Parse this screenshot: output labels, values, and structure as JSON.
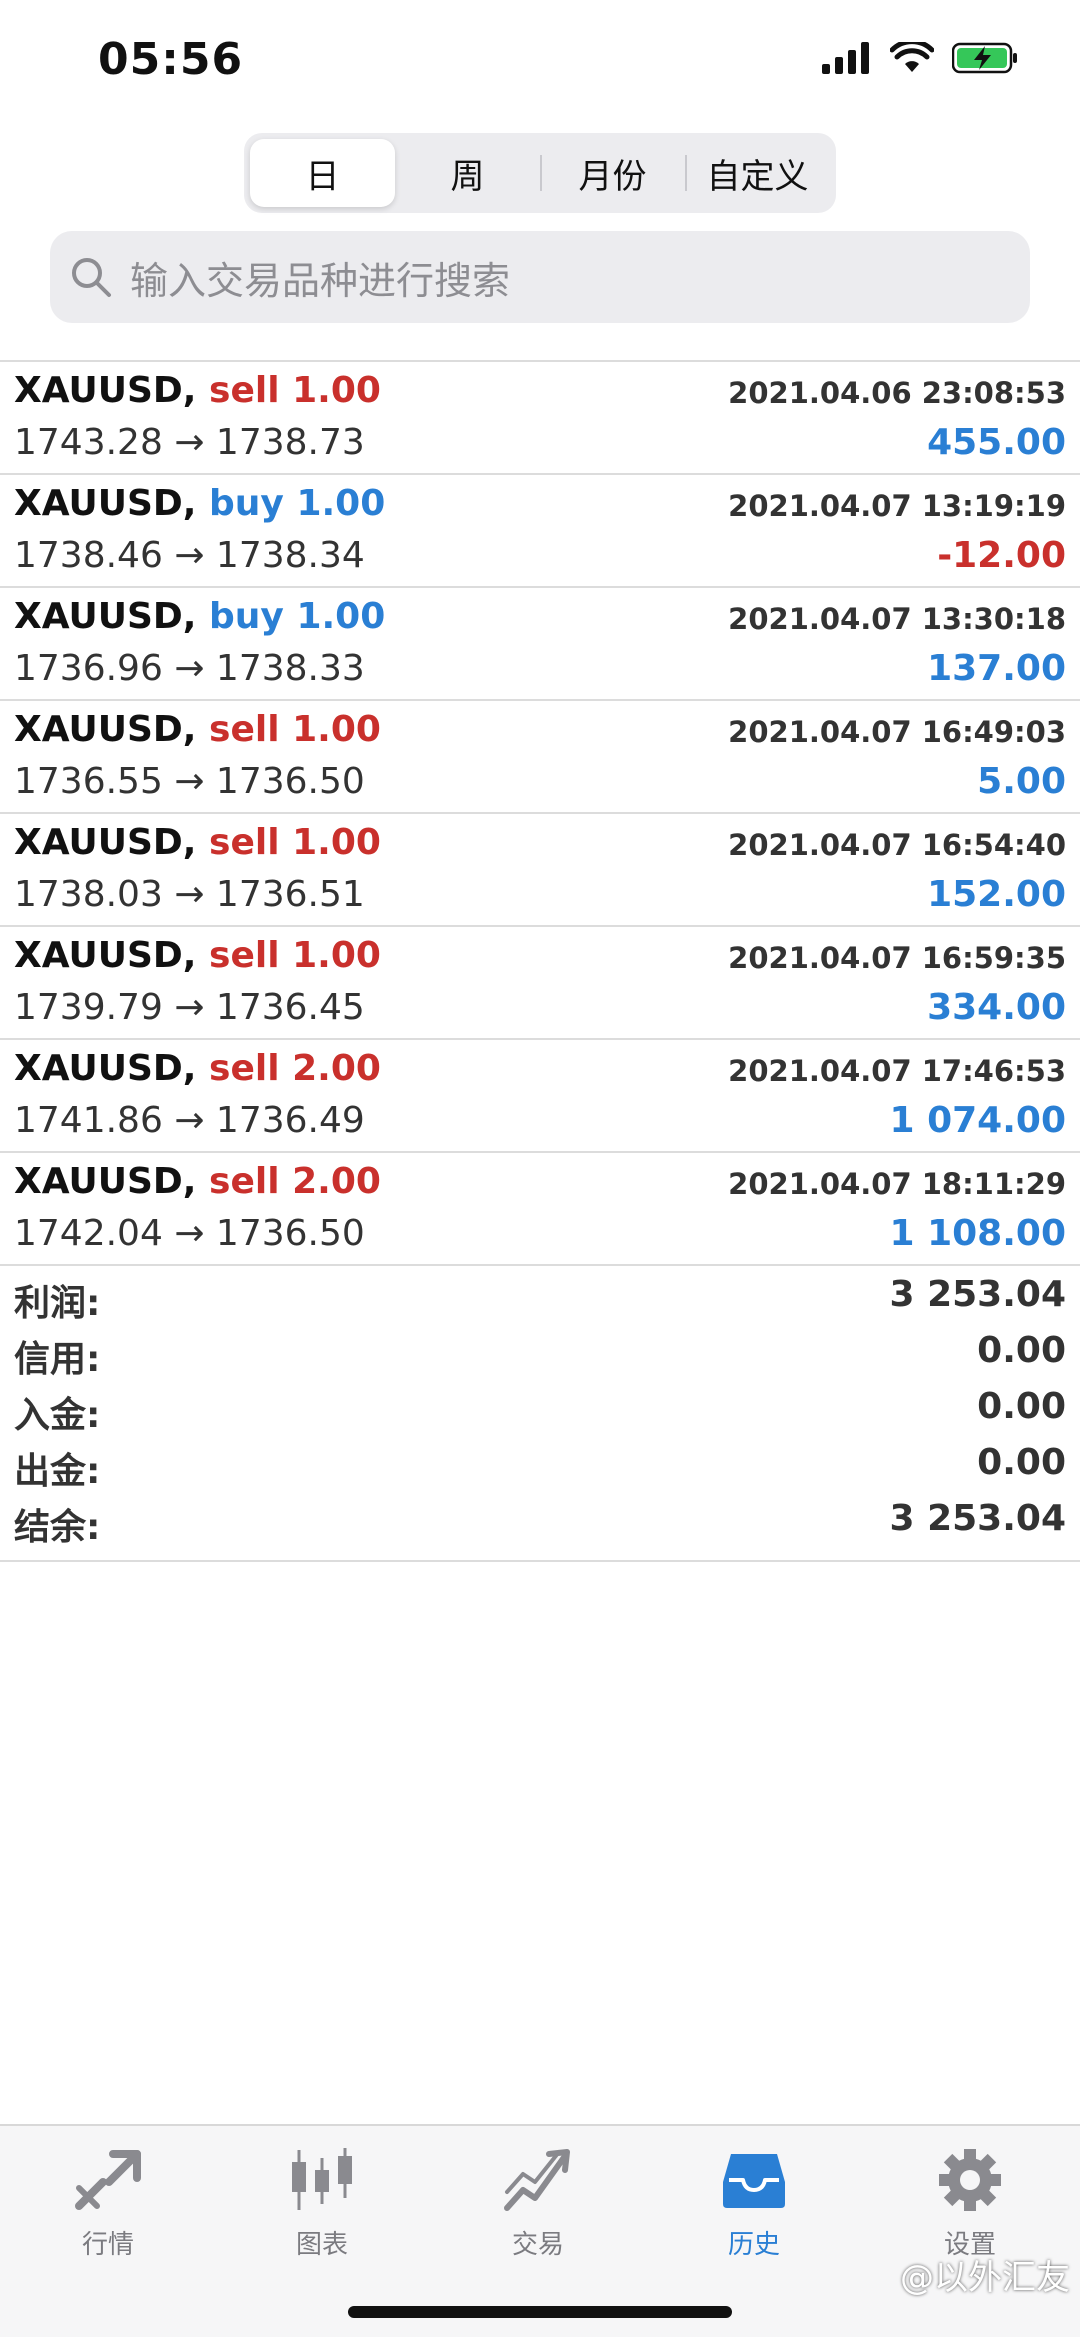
{
  "status": {
    "time": "05:56"
  },
  "segments": [
    "日",
    "周",
    "月份",
    "自定义"
  ],
  "search": {
    "placeholder": "输入交易品种进行搜索"
  },
  "deals": [
    {
      "symbol": "XAUUSD,",
      "side": "sell",
      "volume": "1.00",
      "time": "2021.04.06 23:08:53",
      "prices": "1743.28 → 1738.73",
      "profit": "455.00"
    },
    {
      "symbol": "XAUUSD,",
      "side": "buy",
      "volume": "1.00",
      "time": "2021.04.07 13:19:19",
      "prices": "1738.46 → 1738.34",
      "profit": "-12.00"
    },
    {
      "symbol": "XAUUSD,",
      "side": "buy",
      "volume": "1.00",
      "time": "2021.04.07 13:30:18",
      "prices": "1736.96 → 1738.33",
      "profit": "137.00"
    },
    {
      "symbol": "XAUUSD,",
      "side": "sell",
      "volume": "1.00",
      "time": "2021.04.07 16:49:03",
      "prices": "1736.55 → 1736.50",
      "profit": "5.00"
    },
    {
      "symbol": "XAUUSD,",
      "side": "sell",
      "volume": "1.00",
      "time": "2021.04.07 16:54:40",
      "prices": "1738.03 → 1736.51",
      "profit": "152.00"
    },
    {
      "symbol": "XAUUSD,",
      "side": "sell",
      "volume": "1.00",
      "time": "2021.04.07 16:59:35",
      "prices": "1739.79 → 1736.45",
      "profit": "334.00"
    },
    {
      "symbol": "XAUUSD,",
      "side": "sell",
      "volume": "2.00",
      "time": "2021.04.07 17:46:53",
      "prices": "1741.86 → 1736.49",
      "profit": "1 074.00"
    },
    {
      "symbol": "XAUUSD,",
      "side": "sell",
      "volume": "2.00",
      "time": "2021.04.07 18:11:29",
      "prices": "1742.04 → 1736.50",
      "profit": "1 108.00"
    }
  ],
  "summary": {
    "profit_label": "利润:",
    "profit": "3 253.04",
    "credit_label": "信用:",
    "credit": "0.00",
    "deposit_label": "入金:",
    "deposit": "0.00",
    "withdrawal_label": "出金:",
    "withdrawal": "0.00",
    "balance_label": "结余:",
    "balance": "3 253.04"
  },
  "tabbar": {
    "quotes": "行情",
    "charts": "图表",
    "trade": "交易",
    "history": "历史",
    "settings": "设置"
  },
  "watermark": "@以外汇友",
  "colors": {
    "sell": "#c9302c",
    "buy": "#2a7fd4",
    "active_tab": "#2a7fd4"
  }
}
